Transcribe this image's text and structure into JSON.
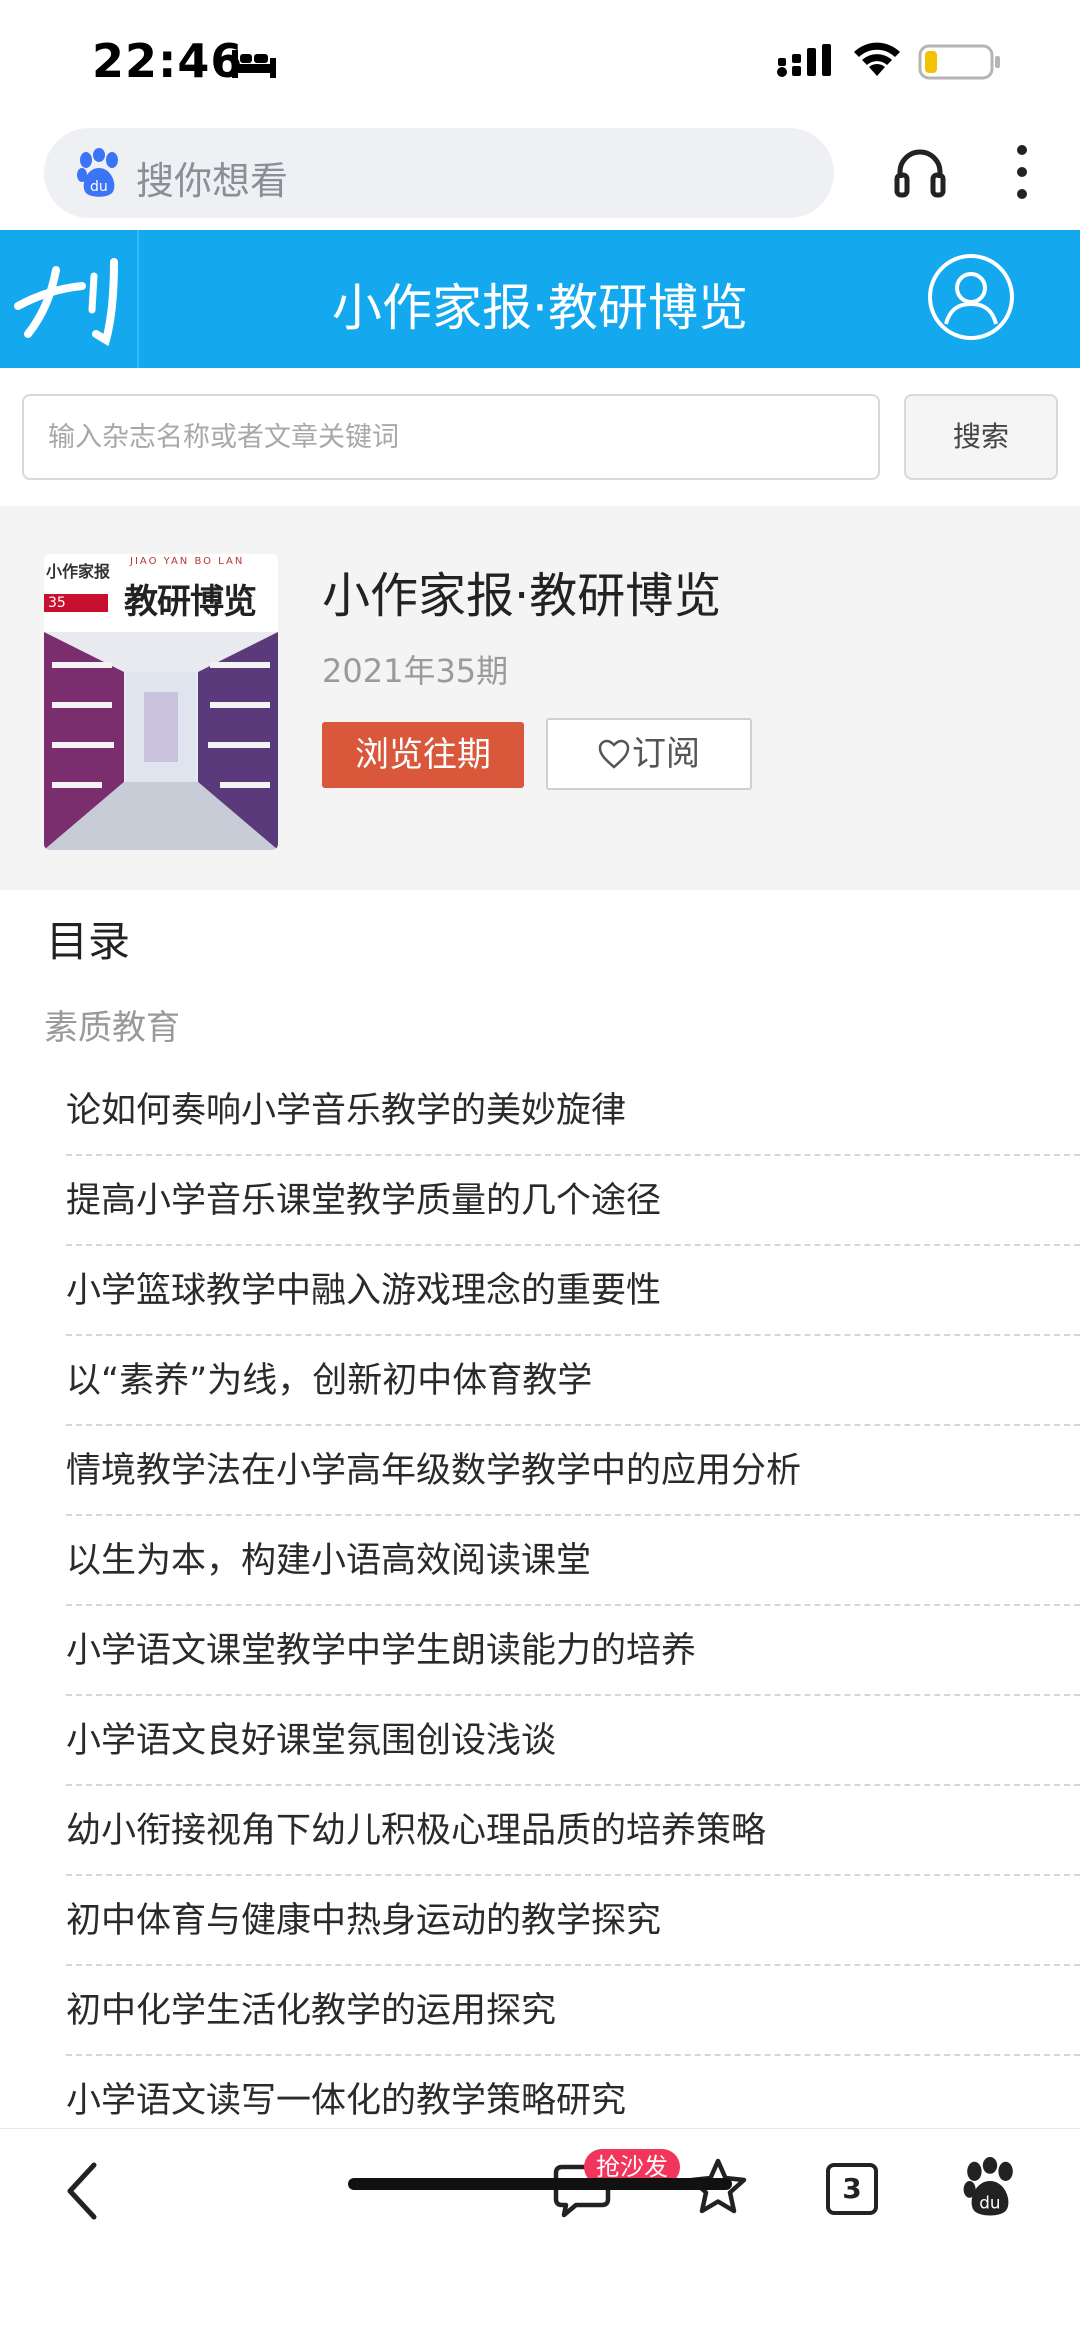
{
  "status_bar": {
    "time": "22:46",
    "icons": [
      "bed-icon",
      "signal-icon",
      "wifi-icon",
      "battery-icon"
    ]
  },
  "browser": {
    "search_placeholder": "搜你想看",
    "icons": [
      "paw-icon",
      "headphone-icon",
      "more-icon"
    ]
  },
  "site": {
    "logo_text": "刊",
    "title": "小作家报·教研博览"
  },
  "mag_search": {
    "placeholder": "输入杂志名称或者文章关键词",
    "button": "搜索"
  },
  "magazine": {
    "cover_brand": "小作家报",
    "cover_pinyin": "JIAO YAN BO LAN",
    "cover_title": "教研博览",
    "cover_issue_tag": "35",
    "name": "小作家报·教研博览",
    "issue": "2021年35期",
    "browse_label": "浏览往期",
    "subscribe_label": "订阅"
  },
  "toc": {
    "heading": "目录",
    "section": "素质教育",
    "items": [
      "论如何奏响小学音乐教学的美妙旋律",
      "提高小学音乐课堂教学质量的几个途径",
      "小学篮球教学中融入游戏理念的重要性",
      "以“素养”为线，创新初中体育教学",
      "情境教学法在小学高年级数学教学中的应用分析",
      "以生为本，构建小语高效阅读课堂",
      "小学语文课堂教学中学生朗读能力的培养",
      "小学语文良好课堂氛围创设浅谈",
      "幼小衔接视角下幼儿积极心理品质的培养策略",
      "初中体育与健康中热身运动的教学探究",
      "初中化学生活化教学的运用探究",
      "小学语文读写一体化的教学策略研究"
    ]
  },
  "bottom_bar": {
    "sofa_badge": "抢沙发",
    "tab_count": "3"
  },
  "colors": {
    "header_blue": "#14a8ee",
    "browse_button": "#d9583b",
    "badge_red": "#f2355a"
  }
}
